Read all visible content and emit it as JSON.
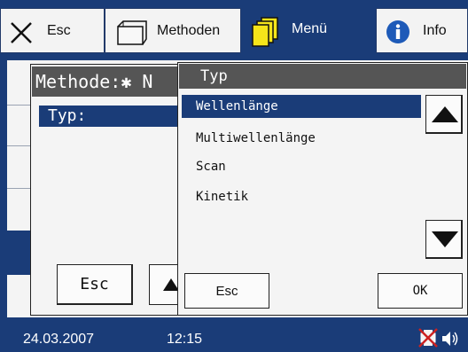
{
  "tabs": {
    "esc": "Esc",
    "methoden": "Methoden",
    "menu": "Menü",
    "info": "Info"
  },
  "background_dialog": {
    "title": "Methode:✱ N",
    "field_label": "Typ:",
    "esc_label": "Esc"
  },
  "popup": {
    "title": "Typ",
    "options": [
      "Wellenlänge",
      "Multiwellenlänge",
      "Scan",
      "Kinetik"
    ],
    "selected_index": 0,
    "esc_label": "Esc",
    "ok_label": "OK"
  },
  "status": {
    "date": "24.03.2007",
    "time": "12:15"
  },
  "icons": {
    "esc": "close-x-icon",
    "methoden": "folder-icon",
    "menu": "stacked-pages-icon",
    "info": "info-circle-icon",
    "scroll_up": "triangle-up-icon",
    "scroll_down": "triangle-down-icon",
    "printer": "printer-crossed-icon",
    "speaker": "speaker-icon"
  },
  "colors": {
    "accent_blue": "#1a3c78",
    "title_grey": "#555555",
    "info_blue": "#1e5ab8",
    "menu_yellow": "#f5e51a",
    "cross_red": "#cc2222"
  }
}
